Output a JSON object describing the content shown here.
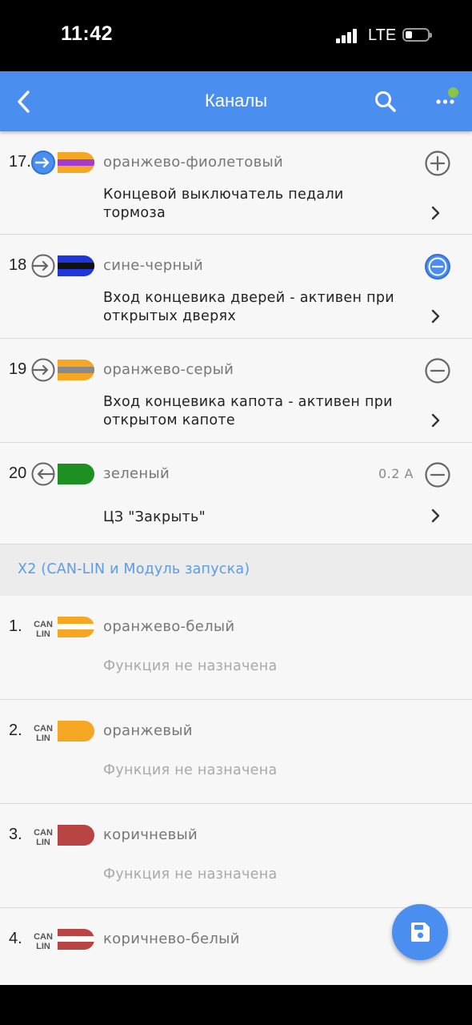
{
  "status_bar": {
    "time": "11:42",
    "network": "LTE"
  },
  "app_bar": {
    "title": "Каналы"
  },
  "channels_x1": [
    {
      "number": "17.",
      "color_name": "оранжево-фиолетовый",
      "function": "Концевой выключатель педали тормоза",
      "direction": "input",
      "action": "add",
      "wire_base": "#f5a623",
      "wire_stripe": "#a33ccf"
    },
    {
      "number": "18",
      "color_name": "сине-черный",
      "function": "Вход концевика дверей - активен при открытых дверях",
      "direction": "input",
      "action": "remove-active",
      "wire_base": "#1f37d8",
      "wire_stripe": "#111111"
    },
    {
      "number": "19",
      "color_name": "оранжево-серый",
      "function": "Вход концевика капота - активен при открытом капоте",
      "direction": "input",
      "action": "remove",
      "wire_base": "#f5a623",
      "wire_stripe": "#8a8a8a"
    },
    {
      "number": "20",
      "color_name": "зеленый",
      "current": "0.2 A",
      "function": "ЦЗ \"Закрыть\"",
      "direction": "output",
      "action": "remove",
      "wire_base": "#1e8f22"
    }
  ],
  "section_x2": {
    "title": "X2 (CAN-LIN и Модуль запуска)"
  },
  "channels_x2": [
    {
      "number": "1.",
      "badge_top": "CAN",
      "badge_bottom": "LIN",
      "color_name": "оранжево-белый",
      "function": "Функция не назначена",
      "wire_base": "#f5a623",
      "wire_stripe": "#ffffff"
    },
    {
      "number": "2.",
      "badge_top": "CAN",
      "badge_bottom": "LIN",
      "color_name": "оранжевый",
      "function": "Функция не назначена",
      "wire_base": "#f5a623"
    },
    {
      "number": "3.",
      "badge_top": "CAN",
      "badge_bottom": "LIN",
      "color_name": "коричневый",
      "function": "Функция не назначена",
      "wire_base": "#b94444"
    },
    {
      "number": "4.",
      "badge_top": "CAN",
      "badge_bottom": "LIN",
      "color_name": "коричнево-белый",
      "wire_base": "#b94444",
      "wire_stripe": "#ffffff"
    }
  ],
  "colors": {
    "accent": "#4a8ff0",
    "section_text": "#5a9ce8",
    "muted_text": "#a9a9a9"
  },
  "icons": {
    "back": "chevron-left-icon",
    "search": "search-icon",
    "more": "more-dots-icon",
    "save": "save-icon"
  }
}
